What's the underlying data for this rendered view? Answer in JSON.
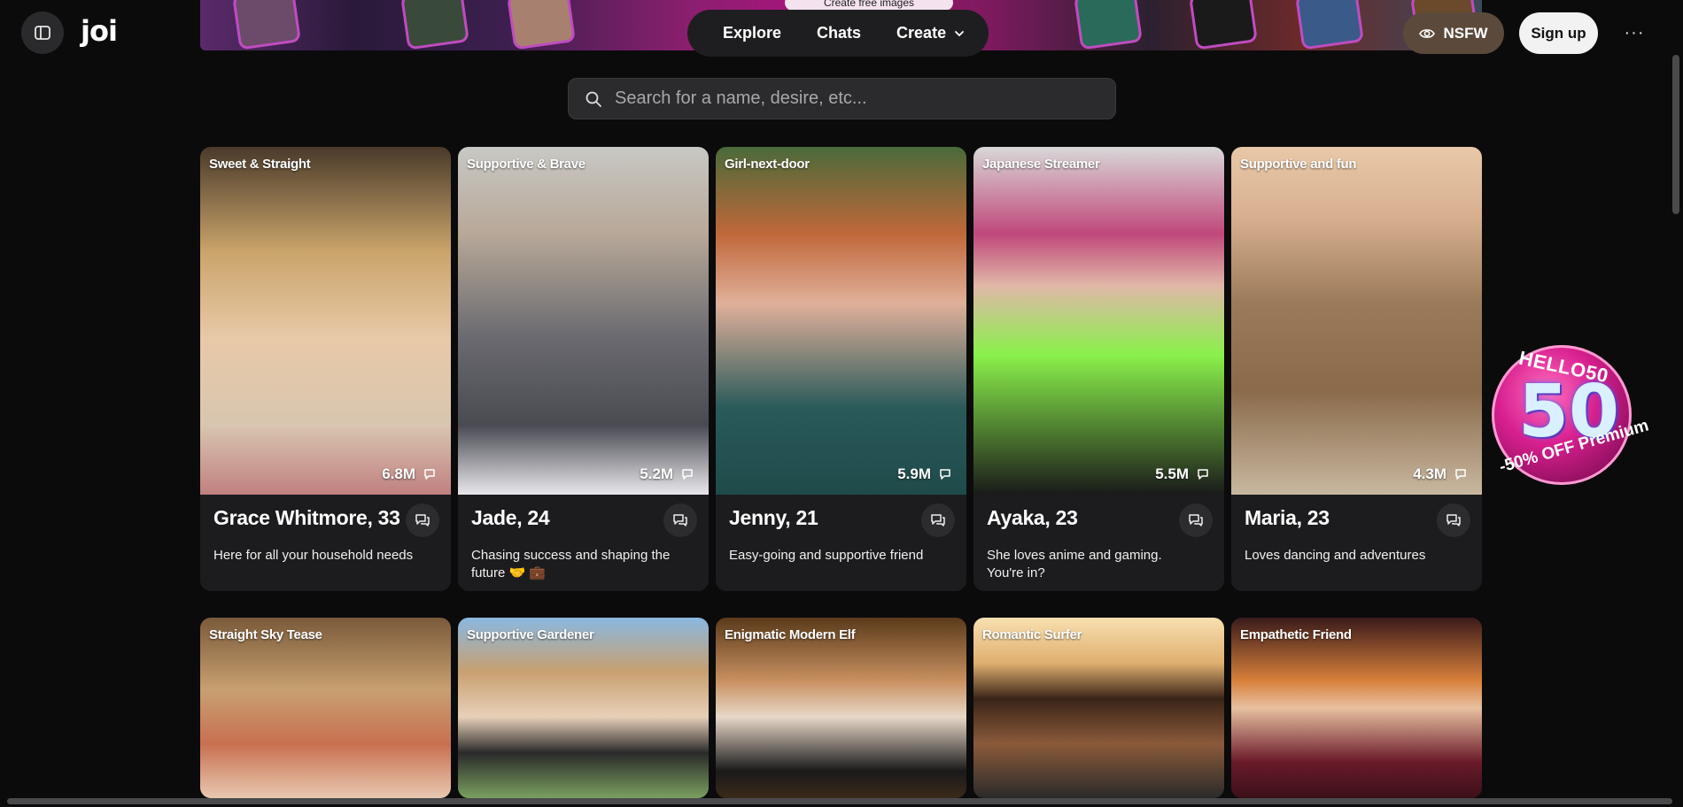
{
  "header": {
    "logo": "joi",
    "banner_text": "Create free images",
    "nav": [
      {
        "label": "Explore"
      },
      {
        "label": "Chats"
      },
      {
        "label": "Create"
      }
    ],
    "nsfw_label": "NSFW",
    "signup_label": "Sign up",
    "more_label": "···"
  },
  "search": {
    "placeholder": "Search for a name, desire, etc..."
  },
  "cards": [
    {
      "tag": "Sweet & Straight",
      "count": "6.8M",
      "name": "Grace Whitmore, 33",
      "desc": "Here for all your household needs"
    },
    {
      "tag": "Supportive & Brave",
      "count": "5.2M",
      "name": "Jade, 24",
      "desc": "Chasing success and shaping the future 🤝 💼"
    },
    {
      "tag": "Girl-next-door",
      "count": "5.9M",
      "name": "Jenny, 21",
      "desc": "Easy-going and supportive friend"
    },
    {
      "tag": "Japanese Streamer",
      "count": "5.5M",
      "name": "Ayaka, 23",
      "desc": "She loves anime and gaming. You're in?"
    },
    {
      "tag": "Supportive and fun",
      "count": "4.3M",
      "name": "Maria, 23",
      "desc": "Loves dancing and adventures"
    },
    {
      "tag": "Straight Sky Tease"
    },
    {
      "tag": "Supportive Gardener"
    },
    {
      "tag": "Enigmatic Modern Elf"
    },
    {
      "tag": "Romantic Surfer"
    },
    {
      "tag": "Empathetic Friend"
    }
  ],
  "promo": {
    "code": "HELLO50",
    "value": "50",
    "offer": "-50% OFF Premium"
  },
  "colors": {
    "background": "#0b0b0c",
    "card": "#1c1c1e",
    "nsfw_button": "#5b4a3b",
    "promo_pink": "#d8208f"
  }
}
